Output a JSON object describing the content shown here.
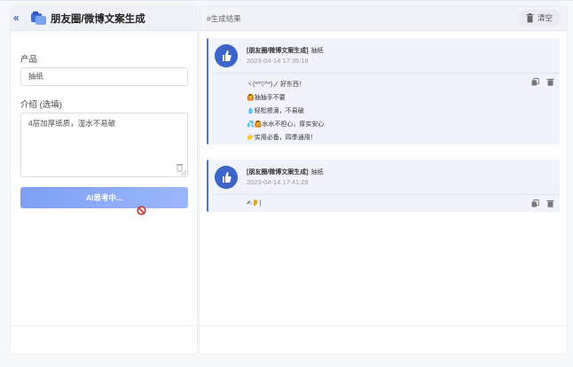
{
  "sidebar": {
    "collapse_icon": "double-chevron-left-icon",
    "app_title": "朋友圈/微博文案生成",
    "product_label": "产品",
    "product_value": "抽纸",
    "intro_label": "介绍 (选填)",
    "intro_value": "4层加厚纸质，湿水不易破",
    "generate_button": "AI思考中..."
  },
  "results": {
    "title": "#生成结果",
    "clear_label": "清空",
    "cards": [
      {
        "source": "[朋友圈/微博文案生成]",
        "product": "抽纸",
        "time": "2023-04-14 17:35:18",
        "lines": [
          "ヽ(*^▽^*)ノ 好东西！",
          "🙆抽抽手不要",
          "💧轻松擦滴，不易破",
          "💦🙆水水不担心，厚实安心",
          "👉实用必备，四季通用！"
        ]
      },
      {
        "source": "[朋友圈/微博文案生成]",
        "product": "抽纸",
        "time": "2023-04-14 17:41:28",
        "lines": [
          "✍👂|"
        ]
      }
    ]
  },
  "colors": {
    "accent": "#4d73d8",
    "avatar": "#3c64c9",
    "button_start": "#7e9ff5",
    "button_end": "#9bb6fb",
    "card_bg": "#f0f3fc"
  }
}
